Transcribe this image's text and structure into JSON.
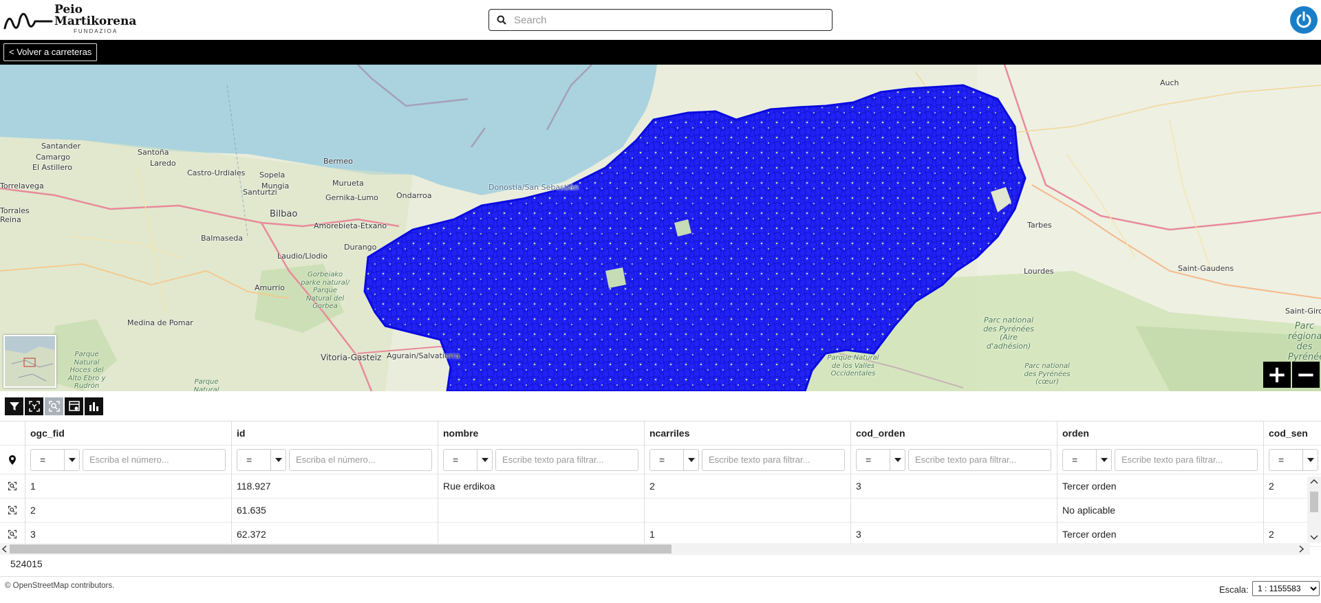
{
  "header": {
    "logo": {
      "line1": "Peio",
      "line2": "Martikorena",
      "line3": "FUNDAZIOA"
    },
    "search_placeholder": "Search"
  },
  "topbar": {
    "back_label": "< Volver a carreteras"
  },
  "map": {
    "places": [
      {
        "text": "Santander",
        "type": "city"
      },
      {
        "text": "Camargo",
        "type": "town"
      },
      {
        "text": "El Astillero",
        "type": "town"
      },
      {
        "text": "Santoña",
        "type": "town"
      },
      {
        "text": "Laredo",
        "type": "town"
      },
      {
        "text": "Castro-Urdiales",
        "type": "town"
      },
      {
        "text": "Bermeo",
        "type": "town"
      },
      {
        "text": "Sopela",
        "type": "town"
      },
      {
        "text": "Mungia",
        "type": "town"
      },
      {
        "text": "Murueta",
        "type": "town"
      },
      {
        "text": "Santurtzi",
        "type": "town"
      },
      {
        "text": "Gernika-Lumo",
        "type": "town"
      },
      {
        "text": "Ondarroa",
        "type": "town"
      },
      {
        "text": "Bilbao",
        "type": "city"
      },
      {
        "text": "Amorebieta-Etxano",
        "type": "town"
      },
      {
        "text": "Balmaseda",
        "type": "town"
      },
      {
        "text": "Durango",
        "type": "town"
      },
      {
        "text": "Laudio/Llodio",
        "type": "town"
      },
      {
        "text": "Amurrio",
        "type": "town"
      },
      {
        "text": "Medina de Pomar",
        "type": "town"
      },
      {
        "text": "Vitoria-Gasteiz",
        "type": "city"
      },
      {
        "text": "Agurain/Salvatierra",
        "type": "town"
      },
      {
        "text": "Donostia/San Sebastián",
        "type": "city"
      },
      {
        "text": "Auch",
        "type": "town"
      },
      {
        "text": "Tarbes",
        "type": "town"
      },
      {
        "text": "Lourdes",
        "type": "town"
      },
      {
        "text": "Saint-Gaudens",
        "type": "town"
      },
      {
        "text": "Saint-Giron",
        "type": "town"
      },
      {
        "text": "Torrelavega",
        "type": "town"
      },
      {
        "text": "Torrales",
        "type": "town"
      },
      {
        "text": "Reina",
        "type": "town"
      }
    ],
    "parks": [
      {
        "text": "Gorbeiako parke natural/ Parque Natural del Gorbea"
      },
      {
        "text": "Parque Natural Hoces del Alto Ebro y Rudrón"
      },
      {
        "text": "Parc national des Pyrénées (Aire d'adhésion)"
      },
      {
        "text": "Parque Natural de los Valles Occidentales"
      },
      {
        "text": "Parc national des Pyrénées (cœur)"
      },
      {
        "text": "Parc régional des Pyrénées"
      },
      {
        "text": "Parque Natural"
      }
    ],
    "zoom_in": "+",
    "zoom_out": "−"
  },
  "toolbar": {
    "buttons": [
      "filter-icon",
      "select-features-icon",
      "zoom-selection-icon",
      "table-settings-icon",
      "chart-icon"
    ]
  },
  "grid": {
    "columns": [
      {
        "key": "ogc_fid",
        "label": "ogc_fid",
        "op": "=",
        "placeholder": "Escriba el número..."
      },
      {
        "key": "id",
        "label": "id",
        "op": "=",
        "placeholder": "Escriba el número..."
      },
      {
        "key": "nombre",
        "label": "nombre",
        "op": "=",
        "placeholder": "Escribe texto para filtrar..."
      },
      {
        "key": "ncarriles",
        "label": "ncarriles",
        "op": "=",
        "placeholder": "Escribe texto para filtrar..."
      },
      {
        "key": "cod_orden",
        "label": "cod_orden",
        "op": "=",
        "placeholder": "Escribe texto para filtrar..."
      },
      {
        "key": "orden",
        "label": "orden",
        "op": "=",
        "placeholder": "Escribe texto para filtrar..."
      },
      {
        "key": "cod_sen",
        "label": "cod_sen",
        "op": "=",
        "placeholder": ""
      }
    ],
    "rows": [
      {
        "ogc_fid": "1",
        "id": "118.927",
        "nombre": "Rue erdikoa",
        "ncarriles": "2",
        "cod_orden": "3",
        "orden": "Tercer orden",
        "cod_sen": "2"
      },
      {
        "ogc_fid": "2",
        "id": "61.635",
        "nombre": "",
        "ncarriles": "",
        "cod_orden": "",
        "orden": "No aplicable",
        "cod_sen": ""
      },
      {
        "ogc_fid": "3",
        "id": "62.372",
        "nombre": "",
        "ncarriles": "1",
        "cod_orden": "3",
        "orden": "Tercer orden",
        "cod_sen": "2"
      }
    ],
    "count": "524015"
  },
  "footer": {
    "attribution": "© OpenStreetMap contributors.",
    "scale_label": "Escala:",
    "scale_value": "1 : 1155583"
  },
  "colors": {
    "accent": "#1a7ec7",
    "network": "#0000ee",
    "sea": "#aad3df"
  }
}
